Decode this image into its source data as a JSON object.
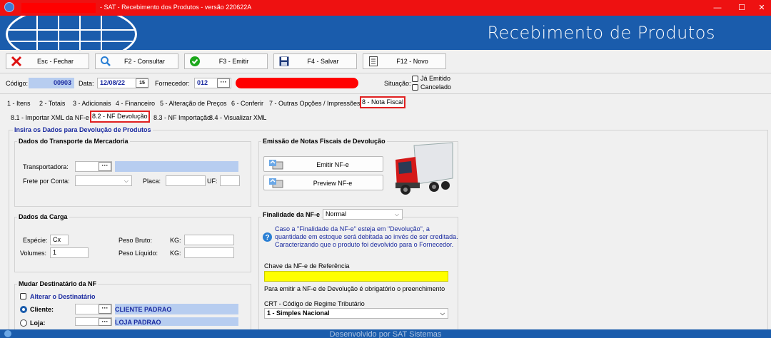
{
  "window": {
    "title": "- SAT - Recebimento dos Produtos - versão 220622A",
    "minimize": "—",
    "maximize": "☐",
    "close": "✕"
  },
  "banner": {
    "title": "Recebimento de Produtos"
  },
  "toolbar": {
    "close": "Esc - Fechar",
    "consult": "F2 - Consultar",
    "emit": "F3 - Emitir",
    "save": "F4 - Salvar",
    "new": "F12 - Novo"
  },
  "header": {
    "code_label": "Código:",
    "code_value": "00903",
    "date_label": "Data:",
    "date_value": "12/08/22",
    "supplier_label": "Fornecedor:",
    "supplier_code": "012",
    "status_label": "Situação:",
    "already_emitted": "Já Emitido",
    "cancelled": "Cancelado"
  },
  "tabs_main": [
    "1 - Itens",
    "2 - Totais",
    "3 - Adicionais",
    "4 - Financeiro",
    "5 - Alteração de Preços",
    "6 - Conferir",
    "7 - Outras Opções / Impressões",
    "8 - Nota Fiscal"
  ],
  "tabs_sub": [
    "8.1 - Importar XML da NF-e",
    "8.2 - NF Devolução",
    "8.3 - NF Importação",
    "8.4 - Visualizar XML"
  ],
  "main_legend": "Insira os Dados para Devolução de Produtos",
  "transport": {
    "title": "Dados do Transporte da Mercadoria",
    "carrier_label": "Transportadora:",
    "freight_label": "Frete por Conta:",
    "plate_label": "Placa:",
    "uf_label": "UF:"
  },
  "cargo": {
    "title": "Dados da Carga",
    "species_label": "Espécie:",
    "species_value": "Cx",
    "volumes_label": "Volumes:",
    "volumes_value": "1",
    "gross_label": "Peso Bruto:",
    "net_label": "Peso Líquido:",
    "kg1": "KG:",
    "kg2": "KG:"
  },
  "recipient": {
    "title": "Mudar Destinatário da NF",
    "change_label": "Alterar o Destinatário",
    "client_label": "Cliente:",
    "client_value": "CLIENTE PADRAO",
    "store_label": "Loja:",
    "store_value": "LOJA PADRAO"
  },
  "emission": {
    "title": "Emissão de Notas Fiscais de Devolução",
    "emit_btn": "Emitir NF-e",
    "preview_btn": "Preview NF-e"
  },
  "purpose": {
    "title": "Finalidade da NF-e",
    "selected": "Normal",
    "info_line1": "Caso a \"Finalidade da NF-e\" esteja em \"Devolução\", a",
    "info_line2": "quantidade em estoque será debitada ao invés de ser creditada.",
    "info_line3": "Caracterizando que o produto foi devolvido para o Fornecedor.",
    "ref_key_label": "Chave da NF-e de Referência",
    "required_note": "Para emitir a NF-e de Devolução é obrigatório o preenchimento",
    "crt_label": "CRT - Código de Regime Tributário",
    "crt_value": "1 - Simples Nacional"
  },
  "footer": {
    "text": "Desenvolvido por SAT Sistemas"
  },
  "icons": [
    "app-icon",
    "close-x-icon",
    "search-icon",
    "check-icon",
    "save-icon",
    "new-doc-icon",
    "calendar-icon",
    "nfe-icon",
    "truck-icon",
    "info-icon"
  ],
  "colors": {
    "title_red": "#ee1111",
    "banner_blue": "#1a5cac",
    "highlight_yellow": "#ffff00",
    "field_blue": "#b7cdf0",
    "legend_blue": "#1a2aa0"
  }
}
